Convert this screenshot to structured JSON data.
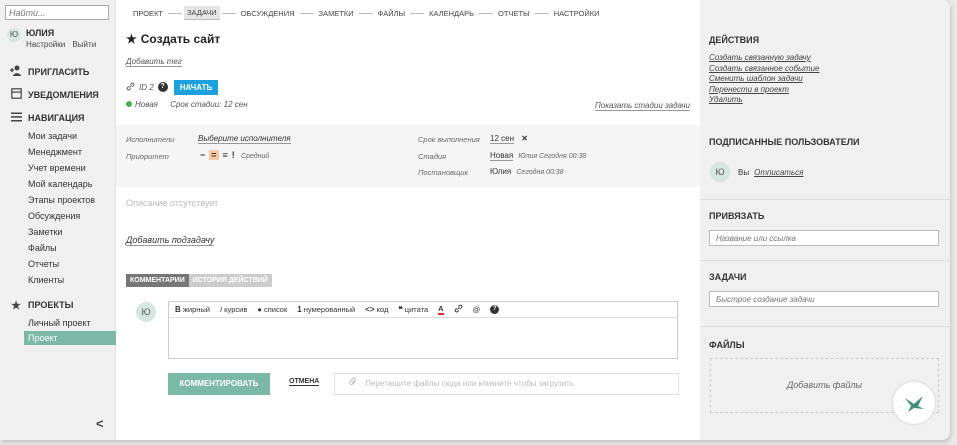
{
  "sidebar": {
    "search_placeholder": "Найти...",
    "user": {
      "avatar": "Ю",
      "name": "ЮЛИЯ",
      "settings": "Настройки",
      "logout": "Выйти"
    },
    "invite": {
      "icon": "add-user-icon",
      "label": "ПРИГЛАСИТЬ"
    },
    "notifications": {
      "icon": "bell-icon",
      "label": "УВЕДОМЛЕНИЯ"
    },
    "navigation": {
      "icon": "menu-icon",
      "label": "НАВИГАЦИЯ",
      "items": [
        "Мои задачи",
        "Менеджмент",
        "Учет времени",
        "Мой календарь",
        "Этапы проектов",
        "Обсуждения",
        "Заметки",
        "Файлы",
        "Отчеты",
        "Клиенты"
      ]
    },
    "projects": {
      "icon": "star-icon",
      "label": "ПРОЕКТЫ",
      "items": [
        "Личный проект",
        "Проект"
      ],
      "active_index": 1
    },
    "collapse": "<"
  },
  "tabs": [
    "ПРОЕКТ",
    "ЗАДАЧИ",
    "ОБСУЖДЕНИЯ",
    "ЗАМЕТКИ",
    "ФАЙЛЫ",
    "КАЛЕНДАРЬ",
    "ОТЧЕТЫ",
    "НАСТРОЙКИ"
  ],
  "active_tab": "ЗАДАЧИ",
  "task": {
    "star": "★",
    "title": "Создать сайт",
    "add_tag": "Добавить тег",
    "id_label": "ID",
    "id_value": "2",
    "start_button": "НАЧАТЬ",
    "status": "Новая",
    "stage_deadline": "Срок стадии: 12 сен",
    "show_stages": "Показать стадии задачи"
  },
  "props": {
    "assignee_label": "Исполнители",
    "assignee_value": "Выберите исполнителя",
    "priority_label": "Приоритет",
    "priority_value": "Средний",
    "deadline_label": "Срок выполнения",
    "deadline_value": "12 сен",
    "stage_label": "Стадия",
    "stage_value": "Новая",
    "stage_meta": "Юлия Сегодня 00:38",
    "author_label": "Постановщик",
    "author_value": "Юлия",
    "author_meta": "Сегодня 00:38"
  },
  "description_empty": "Описание отсутствует",
  "add_subtask": "Добавить подзадачу",
  "comment_tabs": [
    "КОММЕНТАРИИ",
    "ИСТОРИЯ ДЕЙСТВИЙ"
  ],
  "comment": {
    "avatar": "Ю",
    "toolbar": {
      "bold": "жирный",
      "italic": "курсив",
      "list": "список",
      "numbered": "нумерованный",
      "code": "код",
      "quote": "цитата"
    },
    "submit": "КОММЕНТИРОВАТЬ",
    "cancel": "ОТМЕНА",
    "dropzone": "Перетащите файлы сюда или кликните чтобы загрузить"
  },
  "right": {
    "actions_title": "ДЕЙСТВИЯ",
    "actions": [
      "Создать связанную задачу",
      "Создать связанное событие",
      "Сменить шаблон задачи",
      "Перенести в проект",
      "Удалить"
    ],
    "subscribers_title": "ПОДПИСАННЫЕ ПОЛЬЗОВАТЕЛИ",
    "subscriber_avatar": "Ю",
    "subscriber_name": "Вы",
    "unsubscribe": "Отписаться",
    "bind_title": "ПРИВЯЗАТЬ",
    "bind_placeholder": "Название или ссылка",
    "tasks_title": "ЗАДАЧИ",
    "tasks_placeholder": "Быстрое создание задачи",
    "files_title": "ФАЙЛЫ",
    "add_files": "Добавить файлы"
  },
  "colors": {
    "accent": "#7bb8a5",
    "start_button": "#1da1dc",
    "status_green": "#4cae4c"
  }
}
